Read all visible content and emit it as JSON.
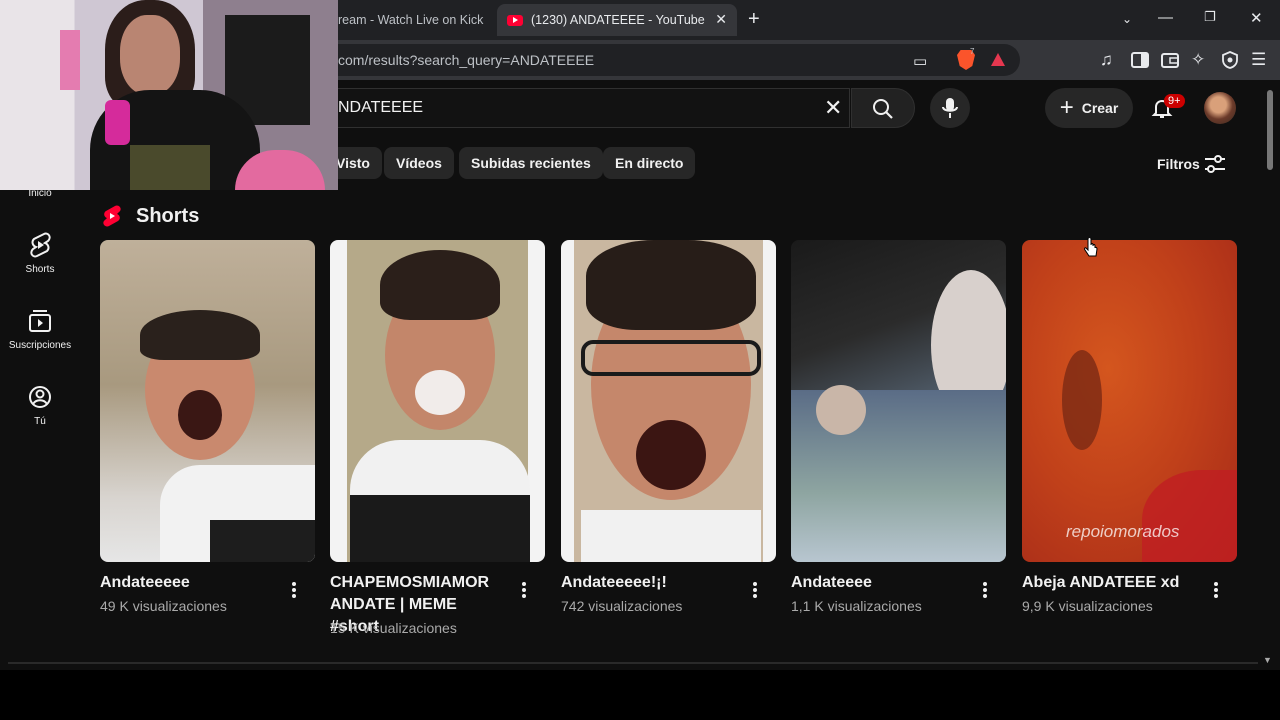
{
  "browser": {
    "tabs": [
      {
        "title": "ream - Watch Live on Kick",
        "active": false
      },
      {
        "title": "(1230) ANDATEEEE - YouTube",
        "active": true
      }
    ],
    "url": "com/results?search_query=ANDATEEEE",
    "brave_badge": "7"
  },
  "youtube": {
    "search_value": "NDATEEEE",
    "create_label": "Crear",
    "notifications_badge": "9+",
    "chips": [
      "Visto",
      "Vídeos",
      "Subidas recientes",
      "En directo"
    ],
    "filters_label": "Filtros",
    "sidebar": [
      {
        "label": "Inicio",
        "icon": "home-icon"
      },
      {
        "label": "Shorts",
        "icon": "shorts-icon"
      },
      {
        "label": "Suscripciones",
        "icon": "subscriptions-icon"
      },
      {
        "label": "Tú",
        "icon": "you-icon"
      }
    ],
    "section_title": "Shorts",
    "shorts": [
      {
        "title": "Andateeeee",
        "views": "49 K visualizaciones"
      },
      {
        "title": "CHAPEMOSMIAMOR ANDATE | MEME #short",
        "views": "15 K visualizaciones"
      },
      {
        "title": "Andateeeee!¡!",
        "views": "742 visualizaciones"
      },
      {
        "title": "Andateeee",
        "views": "1,1 K visualizaciones"
      },
      {
        "title": "Abeja ANDATEEE xd",
        "views": "9,9 K visualizaciones",
        "watermark": "repoiomorados"
      }
    ]
  },
  "colors": {
    "brand_red": "#ff0033",
    "page_bg": "#0f0f0f",
    "chip_bg": "#272727"
  }
}
